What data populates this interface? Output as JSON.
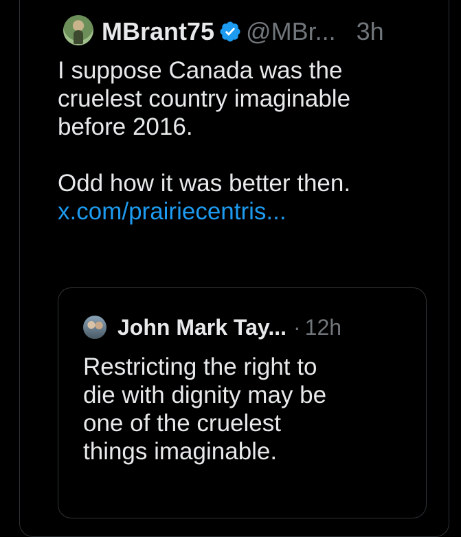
{
  "post": {
    "author_name": "MBrant75",
    "handle": "@MBr...",
    "time": "3h",
    "text_line_1": "I suppose Canada was the",
    "text_line_2": "cruelest country imaginable",
    "text_line_3": "before 2016.",
    "text_line_4": "Odd how it was better then.",
    "link": "x.com/prairiecentris..."
  },
  "quoted": {
    "author_name": "John Mark Tay...",
    "separator": "·",
    "time": "12h",
    "text_line_1": "Restricting the right to",
    "text_line_2": "die with dignity may be",
    "text_line_3": "one of the cruelest",
    "text_line_4": "things imaginable."
  },
  "icons": {
    "verified": "verified-badge-icon",
    "avatar": "avatar"
  },
  "colors": {
    "background": "#000000",
    "text": "#e7e9ea",
    "muted": "#71767b",
    "link": "#1d9bf0",
    "verified": "#1d9bf0",
    "border": "#2f3336"
  }
}
